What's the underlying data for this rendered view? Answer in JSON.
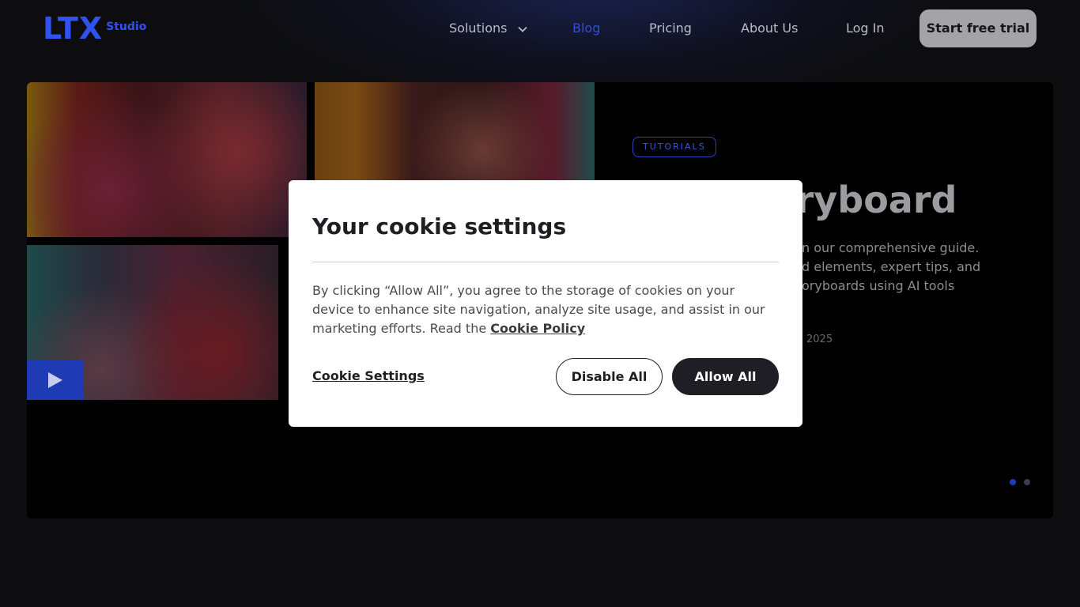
{
  "nav": {
    "logo_text": "LTX",
    "logo_sub": "Studio",
    "links": [
      "Solutions",
      "Blog",
      "Pricing",
      "About Us",
      "Log In"
    ],
    "cta": "Start free trial"
  },
  "hero": {
    "badge": "TUTORIALS",
    "title_fragment": "oryboard",
    "desc_lines": [
      "n our comprehensive guide.",
      "d elements, expert tips, and",
      "oryboards using AI tools"
    ],
    "date_fragment": "2025",
    "slides_count": 2
  },
  "cookie_modal": {
    "title": "Your cookie settings",
    "body": "By clicking “Allow All”, you agree to the storage of cookies on your device to enhance site navigation, analyze site usage, and assist in our marketing efforts. Read the",
    "policy_link": "Cookie Policy",
    "settings_link": "Cookie Settings",
    "disable_label": "Disable All",
    "allow_label": "Allow All"
  },
  "colors": {
    "accent": "#2f52f0",
    "cta_bg": "#a4a4a6",
    "dark_button": "#1e1e24"
  }
}
